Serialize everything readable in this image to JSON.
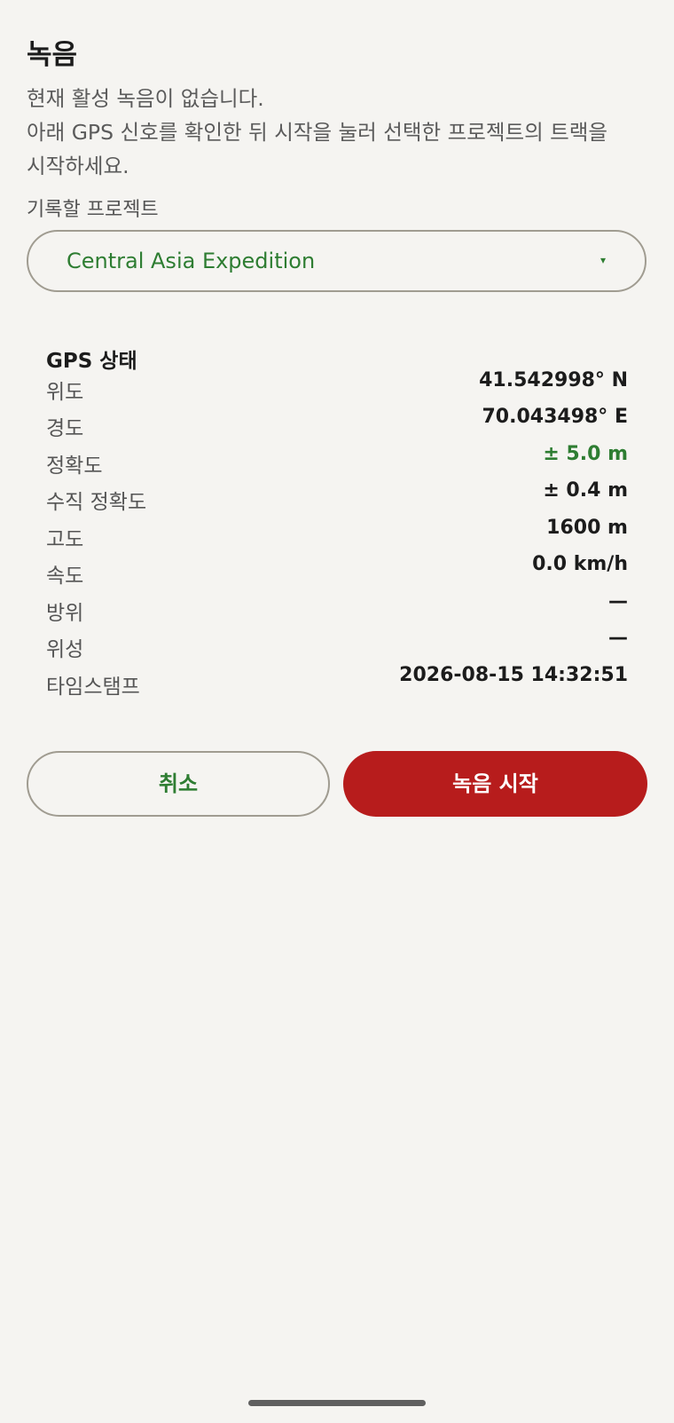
{
  "header": {
    "title": "녹음"
  },
  "description": {
    "line1": "현재 활성 녹음이 없습니다.",
    "line2": "아래 GPS 신호를 확인한 뒤 시작을 눌러 선택한 프로젝트의 트랙을",
    "line3": "시작하세요."
  },
  "project": {
    "label": "기록할 프로젝트",
    "selected": "Central Asia Expedition",
    "arrow_icon": "▾"
  },
  "gps": {
    "title": "GPS 상태",
    "rows": [
      {
        "label": "위도",
        "value": "41.542998° N"
      },
      {
        "label": "경도",
        "value": "70.043498° E"
      },
      {
        "label": "정확도",
        "value": "± 5.0 m"
      },
      {
        "label": "수직 정확도",
        "value": "± 0.4 m"
      },
      {
        "label": "고도",
        "value": "1600 m"
      },
      {
        "label": "속도",
        "value": "0.0 km/h"
      },
      {
        "label": "방위",
        "value": "—"
      },
      {
        "label": "위성",
        "value": "—"
      },
      {
        "label": "타임스탬프",
        "value": "2026-08-15 14:32:51"
      }
    ]
  },
  "actions": {
    "cancel_label": "취소",
    "start_label": "녹음 시작"
  },
  "colors": {
    "accent_green": "#2e7d32",
    "record_red": "#b71c1c",
    "background": "#f5f4f1"
  }
}
